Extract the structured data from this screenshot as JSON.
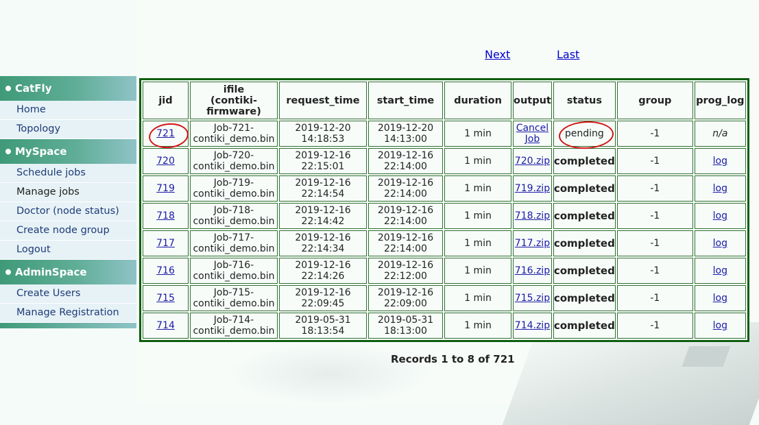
{
  "pager": {
    "next": "Next",
    "last": "Last"
  },
  "sidebar": {
    "sections": [
      {
        "title": "CatFly",
        "items": [
          "Home",
          "Topology"
        ]
      },
      {
        "title": "MySpace",
        "items": [
          "Schedule jobs",
          "Manage jobs",
          "Doctor (node status)",
          "Create node group",
          "Logout"
        ]
      },
      {
        "title": "AdminSpace",
        "items": [
          "Create Users",
          "Manage Registration"
        ]
      }
    ]
  },
  "table": {
    "headers": {
      "jid": "jid",
      "ifile_1": "ifile",
      "ifile_2": "(contiki-",
      "ifile_3": "firmware)",
      "request_time": "request_time",
      "start_time": "start_time",
      "duration": "duration",
      "output": "output",
      "status": "status",
      "group": "group",
      "prog_log": "prog_log"
    },
    "rows": [
      {
        "jid": "721 ",
        "ifile1": "Job-721-",
        "ifile2": "contiki_demo.bin",
        "req1": "2019-12-20",
        "req2": "14:18:53",
        "start1": "2019-12-20",
        "start2": "14:13:00",
        "duration": "1 min",
        "output1": "Cancel",
        "output2": "Job",
        "status": "pending",
        "group": "-1",
        "log": "n/a"
      },
      {
        "jid": "720 ",
        "ifile1": "Job-720-",
        "ifile2": "contiki_demo.bin",
        "req1": "2019-12-16",
        "req2": "22:15:01",
        "start1": "2019-12-16",
        "start2": "22:14:00",
        "duration": "1 min",
        "output": "720.zip",
        "status": "completed",
        "group": "-1",
        "log": "log"
      },
      {
        "jid": "719 ",
        "ifile1": "Job-719-",
        "ifile2": "contiki_demo.bin",
        "req1": "2019-12-16",
        "req2": "22:14:54",
        "start1": "2019-12-16",
        "start2": "22:14:00",
        "duration": "1 min",
        "output": "719.zip",
        "status": "completed",
        "group": "-1",
        "log": "log"
      },
      {
        "jid": "718 ",
        "ifile1": "Job-718-",
        "ifile2": "contiki_demo.bin",
        "req1": "2019-12-16",
        "req2": "22:14:42",
        "start1": "2019-12-16",
        "start2": "22:14:00",
        "duration": "1 min",
        "output": "718.zip",
        "status": "completed",
        "group": "-1",
        "log": "log"
      },
      {
        "jid": "717 ",
        "ifile1": "Job-717-",
        "ifile2": "contiki_demo.bin",
        "req1": "2019-12-16",
        "req2": "22:14:34",
        "start1": "2019-12-16",
        "start2": "22:14:00",
        "duration": "1 min",
        "output": "717.zip",
        "status": "completed",
        "group": "-1",
        "log": "log"
      },
      {
        "jid": "716 ",
        "ifile1": "Job-716-",
        "ifile2": "contiki_demo.bin",
        "req1": "2019-12-16",
        "req2": "22:14:26",
        "start1": "2019-12-16",
        "start2": "22:12:00",
        "duration": "1 min",
        "output": "716.zip",
        "status": "completed",
        "group": "-1",
        "log": "log"
      },
      {
        "jid": "715 ",
        "ifile1": "Job-715-",
        "ifile2": "contiki_demo.bin",
        "req1": "2019-12-16",
        "req2": "22:09:45",
        "start1": "2019-12-16",
        "start2": "22:09:00",
        "duration": "1 min",
        "output": "715.zip",
        "status": "completed",
        "group": "-1",
        "log": "log"
      },
      {
        "jid": "714 ",
        "ifile1": "Job-714-",
        "ifile2": "contiki_demo.bin",
        "req1": "2019-05-31",
        "req2": "18:13:54",
        "start1": "2019-05-31",
        "start2": "18:13:00",
        "duration": "1 min",
        "output": "714.zip",
        "status": "completed",
        "group": "-1",
        "log": "log"
      }
    ]
  },
  "footer": {
    "records": "Records 1 to 8 of 721"
  }
}
